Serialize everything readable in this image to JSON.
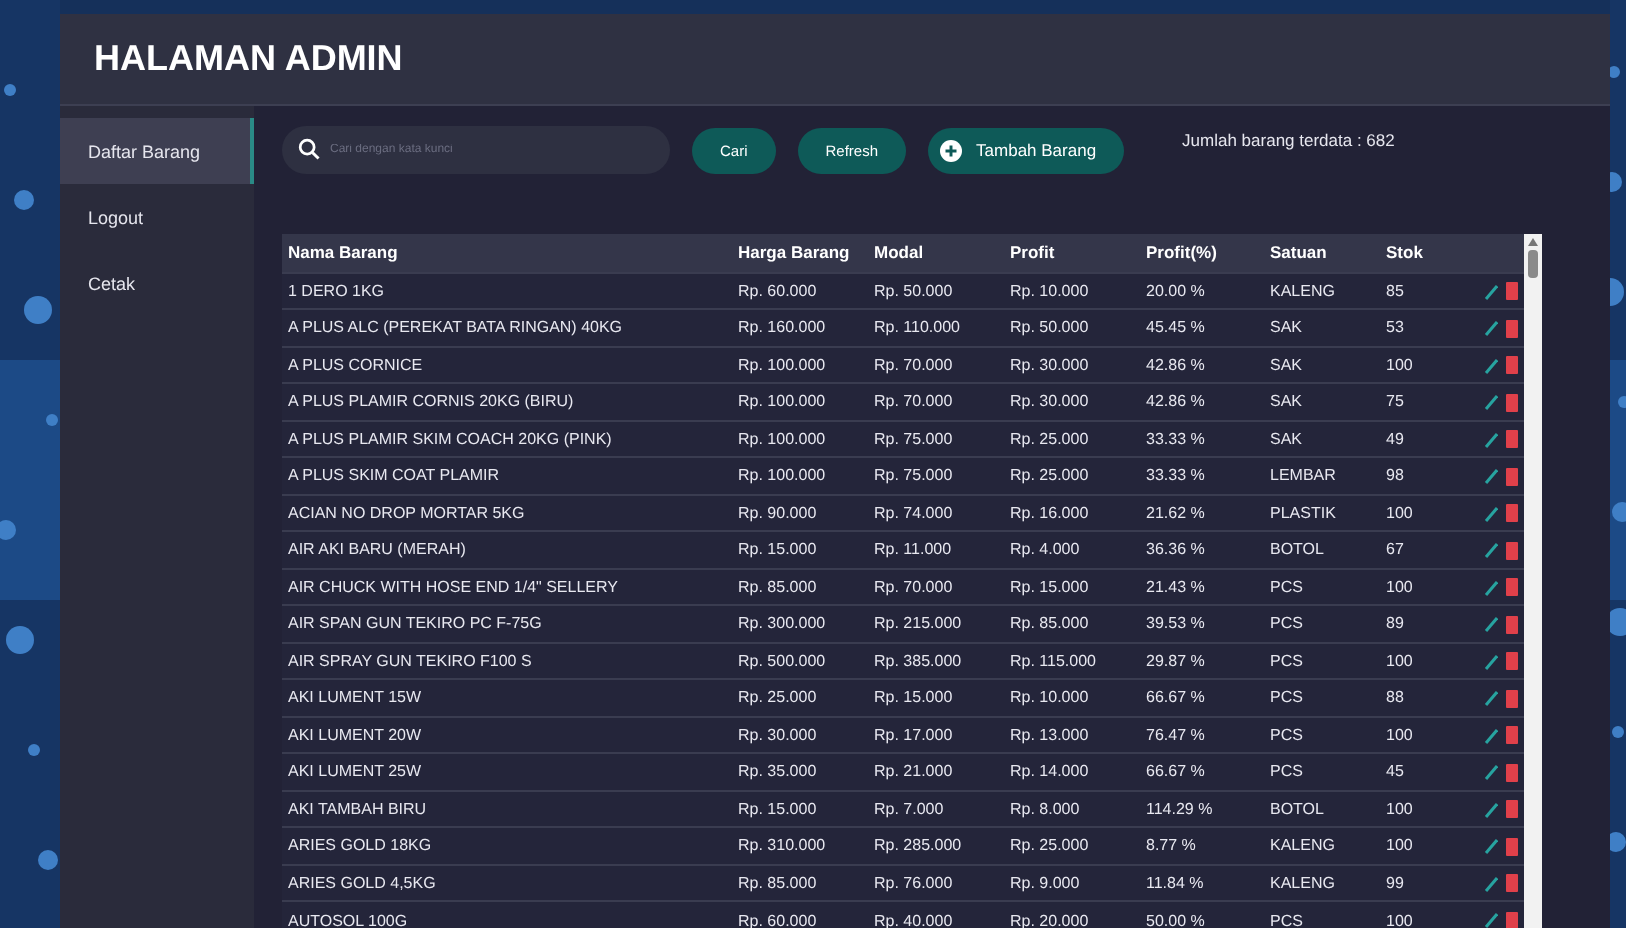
{
  "window": {
    "title": "HALAMAN ADMIN"
  },
  "sidebar": {
    "items": [
      {
        "label": "Daftar Barang",
        "selected": true
      },
      {
        "label": "Logout",
        "selected": false
      },
      {
        "label": "Cetak",
        "selected": false
      }
    ]
  },
  "toolbar": {
    "search": {
      "placeholder": "Cari dengan kata kunci"
    },
    "buttons": [
      {
        "label": "Cari",
        "kind": "plain"
      },
      {
        "label": "Refresh",
        "kind": "plain"
      },
      {
        "label": "Tambah Barang",
        "kind": "add"
      }
    ],
    "count": "Jumlah barang terdata : 682"
  },
  "table": {
    "columns": [
      "Nama Barang",
      "Harga Barang",
      "Modal",
      "Profit",
      "Profit(%)",
      "Satuan",
      "Stok"
    ],
    "rows": [
      [
        "1 DERO 1KG",
        "Rp. 60.000",
        "Rp. 50.000",
        "Rp. 10.000",
        "20.00 %",
        "KALENG",
        "85"
      ],
      [
        "A PLUS ALC (PEREKAT BATA RINGAN) 40KG",
        "Rp. 160.000",
        "Rp. 110.000",
        "Rp. 50.000",
        "45.45 %",
        "SAK",
        "53"
      ],
      [
        "A PLUS CORNICE",
        "Rp. 100.000",
        "Rp. 70.000",
        "Rp. 30.000",
        "42.86 %",
        "SAK",
        "100"
      ],
      [
        "A PLUS PLAMIR CORNIS 20KG (BIRU)",
        "Rp. 100.000",
        "Rp. 70.000",
        "Rp. 30.000",
        "42.86 %",
        "SAK",
        "75"
      ],
      [
        "A PLUS PLAMIR SKIM COACH 20KG (PINK)",
        "Rp. 100.000",
        "Rp. 75.000",
        "Rp. 25.000",
        "33.33 %",
        "SAK",
        "49"
      ],
      [
        "A PLUS SKIM COAT PLAMIR",
        "Rp. 100.000",
        "Rp. 75.000",
        "Rp. 25.000",
        "33.33 %",
        "LEMBAR",
        "98"
      ],
      [
        "ACIAN NO DROP MORTAR 5KG",
        "Rp. 90.000",
        "Rp. 74.000",
        "Rp. 16.000",
        "21.62 %",
        "PLASTIK",
        "100"
      ],
      [
        "AIR AKI BARU (MERAH)",
        "Rp. 15.000",
        "Rp. 11.000",
        "Rp. 4.000",
        "36.36 %",
        "BOTOL",
        "67"
      ],
      [
        "AIR CHUCK WITH HOSE END 1/4\" SELLERY",
        "Rp. 85.000",
        "Rp. 70.000",
        "Rp. 15.000",
        "21.43 %",
        "PCS",
        "100"
      ],
      [
        "AIR SPAN GUN TEKIRO PC F-75G",
        "Rp. 300.000",
        "Rp. 215.000",
        "Rp. 85.000",
        "39.53 %",
        "PCS",
        "89"
      ],
      [
        "AIR SPRAY GUN TEKIRO F100 S",
        "Rp. 500.000",
        "Rp. 385.000",
        "Rp. 115.000",
        "29.87 %",
        "PCS",
        "100"
      ],
      [
        "AKI LUMENT 15W",
        "Rp. 25.000",
        "Rp. 15.000",
        "Rp. 10.000",
        "66.67 %",
        "PCS",
        "88"
      ],
      [
        "AKI LUMENT 20W",
        "Rp. 30.000",
        "Rp. 17.000",
        "Rp. 13.000",
        "76.47 %",
        "PCS",
        "100"
      ],
      [
        "AKI LUMENT 25W",
        "Rp. 35.000",
        "Rp. 21.000",
        "Rp. 14.000",
        "66.67 %",
        "PCS",
        "45"
      ],
      [
        "AKI TAMBAH BIRU",
        "Rp. 15.000",
        "Rp. 7.000",
        "Rp. 8.000",
        "114.29 %",
        "BOTOL",
        "100"
      ],
      [
        "ARIES GOLD 18KG",
        "Rp. 310.000",
        "Rp. 285.000",
        "Rp. 25.000",
        "8.77 %",
        "KALENG",
        "100"
      ],
      [
        "ARIES GOLD 4,5KG",
        "Rp. 85.000",
        "Rp. 76.000",
        "Rp. 9.000",
        "11.84 %",
        "KALENG",
        "99"
      ],
      [
        "AUTOSOL 100G",
        "Rp. 60.000",
        "Rp. 40.000",
        "Rp. 20.000",
        "50.00 %",
        "PCS",
        "100"
      ]
    ]
  }
}
